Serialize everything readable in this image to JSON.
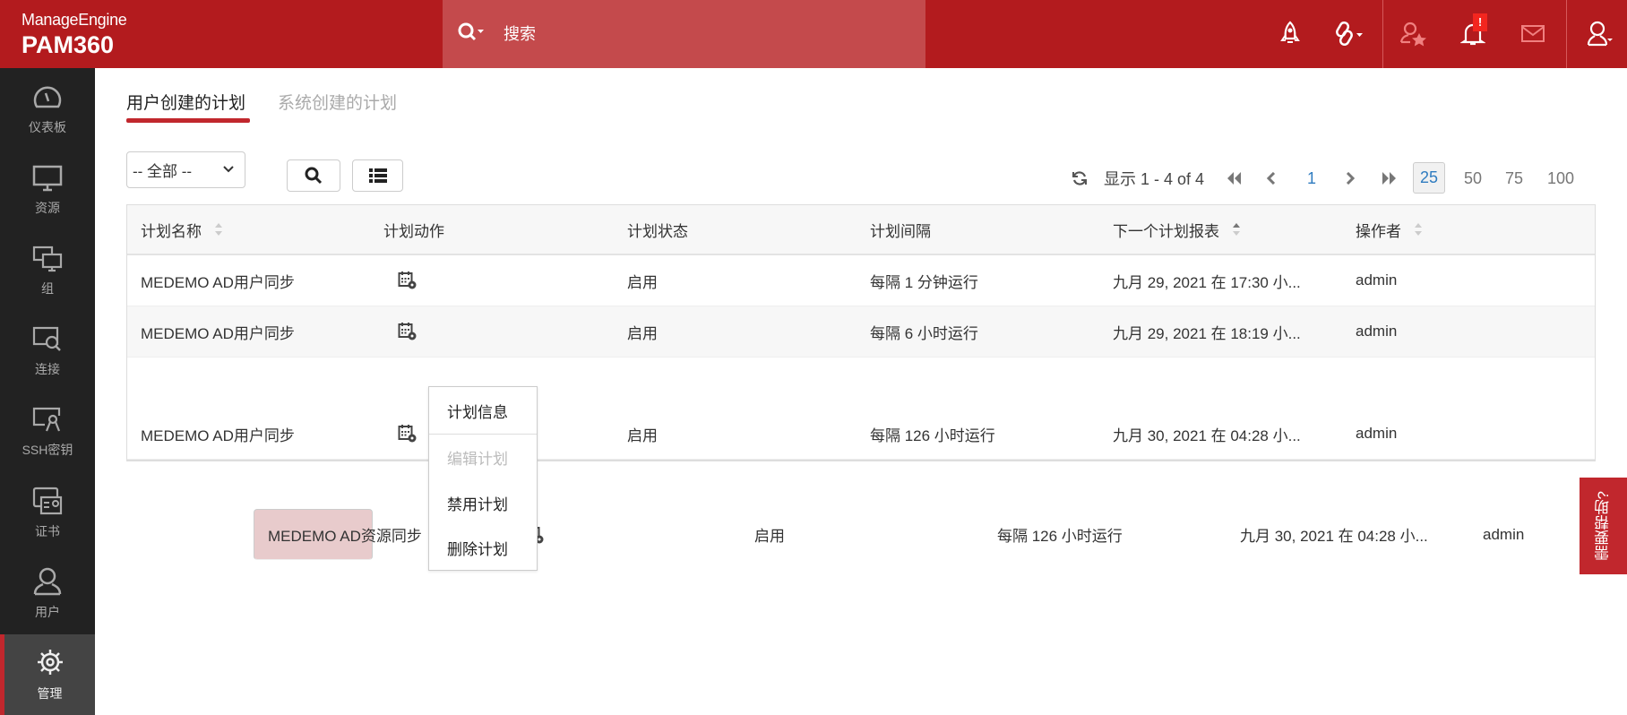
{
  "header": {
    "brand": "ManageEngine",
    "product": "PAM360",
    "search_placeholder": "搜索",
    "notification_badge": "!"
  },
  "sidebar": {
    "items": [
      {
        "label": "仪表板",
        "icon": "dashboard-icon"
      },
      {
        "label": "资源",
        "icon": "monitor-icon"
      },
      {
        "label": "组",
        "icon": "groups-icon"
      },
      {
        "label": "连接",
        "icon": "connection-icon"
      },
      {
        "label": "SSH密钥",
        "icon": "ssh-key-icon"
      },
      {
        "label": "证书",
        "icon": "certificate-icon"
      },
      {
        "label": "用户",
        "icon": "user-icon"
      },
      {
        "label": "管理",
        "icon": "gear-icon",
        "active": true
      }
    ]
  },
  "tabs": [
    {
      "label": "用户创建的计划",
      "active": true
    },
    {
      "label": "系统创建的计划"
    }
  ],
  "toolbar": {
    "filter_value": "-- 全部 --"
  },
  "pagination": {
    "range_text": "显示 1 - 4 of 4",
    "current_page": "1",
    "page_sizes": [
      "25",
      "50",
      "75",
      "100"
    ],
    "selected_size": "25"
  },
  "table": {
    "columns": [
      "计划名称",
      "计划动作",
      "计划状态",
      "计划间隔",
      "下一个计划报表",
      "操作者"
    ],
    "rows": [
      {
        "name": "MEDEMO AD用户同步",
        "status": "启用",
        "interval": "每隔 1 分钟运行",
        "next": "九月 29, 2021 在 17:30 小...",
        "operator": "admin"
      },
      {
        "name": "MEDEMO AD用户同步",
        "status": "启用",
        "interval": "每隔 6 小时运行",
        "next": "九月 29, 2021 在 18:19 小...",
        "operator": "admin"
      },
      {
        "name": "MEDEMO AD资源同步",
        "status": "启用",
        "interval": "每隔 126 小时运行",
        "next": "九月 30, 2021 在 04:28 小...",
        "operator": "admin"
      },
      {
        "name": "MEDEMO AD用户同步",
        "status": "启用",
        "interval": "每隔 126 小时运行",
        "next": "九月 30, 2021 在 04:28 小...",
        "operator": "admin"
      }
    ]
  },
  "context_menu": {
    "items": [
      {
        "label": "计划信息"
      },
      {
        "label": "编辑计划",
        "disabled": true
      },
      {
        "label": "禁用计划"
      },
      {
        "label": "删除计划"
      }
    ]
  },
  "help_tab": "需要帮助?",
  "colors": {
    "brand": "#b31b1e",
    "accent": "#c1272d",
    "selected_row": "#e8cbcc",
    "link": "#2f7cc0"
  }
}
